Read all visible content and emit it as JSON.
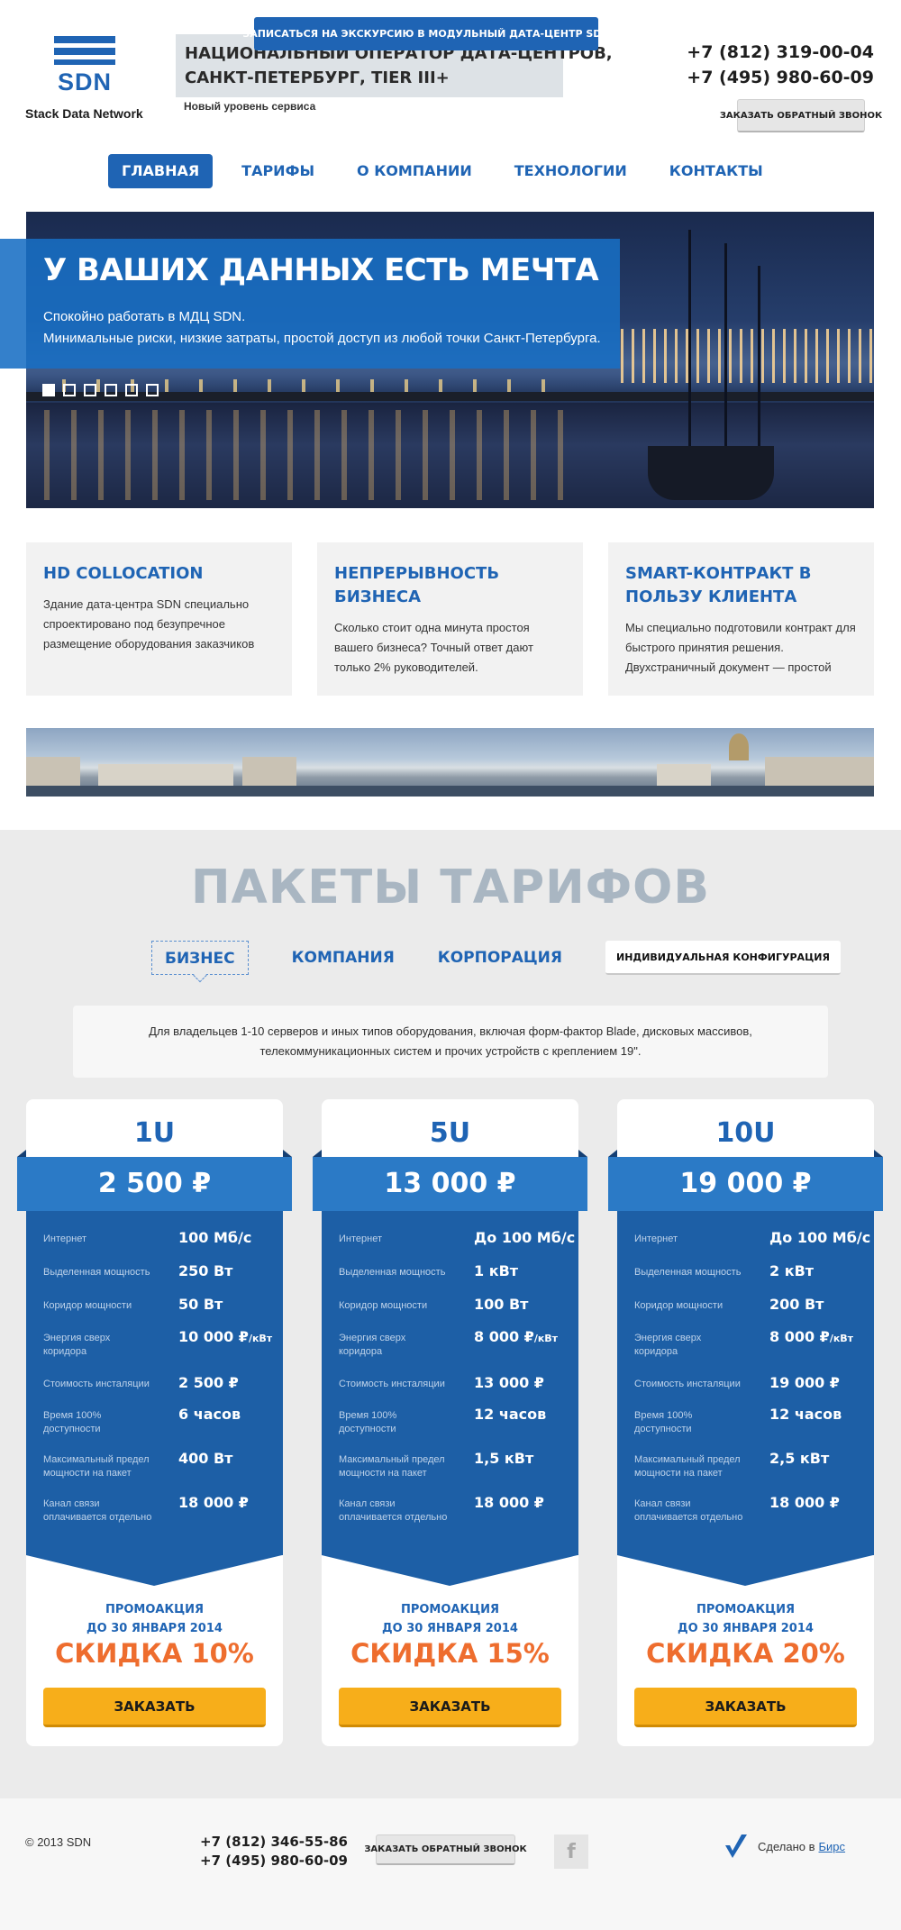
{
  "logo": {
    "text": "SDN",
    "subtitle": "Stack Data Network"
  },
  "header": {
    "headline_line1": "НАЦИОНАЛЬНЫЙ ОПЕРАТОР ДАТА-ЦЕНТРОВ,",
    "headline_line2": "САНКТ-ПЕТЕРБУРГ, TIER III+",
    "tagline": "Новый уровень сервиса",
    "phone1": "+7 (812) 319-00-04",
    "phone2": "+7 (495) 980-60-09",
    "callback_label": "ЗАКАЗАТЬ ОБРАТНЫЙ ЗВОНОК"
  },
  "nav": {
    "items": [
      "ГЛАВНАЯ",
      "ТАРИФЫ",
      "О КОМПАНИИ",
      "ТЕХНОЛОГИИ",
      "КОНТАКТЫ"
    ],
    "active": "ГЛАВНАЯ"
  },
  "hero": {
    "title": "У ВАШИХ ДАННЫХ ЕСТЬ МЕЧТА",
    "line1": "Спокойно работать в МДЦ SDN.",
    "line2": "Минимальные риски, низкие затраты, простой доступ из любой точки Санкт-Петербурга.",
    "slides_count": 6,
    "active_slide": 1
  },
  "features": [
    {
      "title": "HD COLLOCATION",
      "text": "Здание дата-центра SDN специально спроектировано под безупречное размещение оборудования заказчиков"
    },
    {
      "title": "НЕПРЕРЫВНОСТЬ БИЗНЕСА",
      "text": "Сколько стоит одна минута простоя вашего бизнеса? Точный ответ дают только 2% руководителей."
    },
    {
      "title": "SMART-КОНТРАКТ В ПОЛЬЗУ КЛИЕНТА",
      "text": "Мы специально подготовили контракт для быстрого принятия решения. Двухстраничный документ — простой"
    }
  ],
  "banner": {
    "button_label": "ЗАПИСАТЬСЯ НА ЭКСКУРСИЮ В МОДУЛЬНЫЙ ДАТА-ЦЕНТР SDN"
  },
  "tariffs": {
    "title": "ПАКЕТЫ ТАРИФОВ",
    "tabs": [
      "БИЗНЕС",
      "КОМПАНИЯ",
      "КОРПОРАЦИЯ",
      "ИНДИВИДУАЛЬНАЯ КОНФИГУРАЦИЯ"
    ],
    "active_tab": "БИЗНЕС",
    "description": "Для владельцев 1-10 серверов и иных типов оборудования, включая форм-фактор Blade, дисковых массивов, телекоммуникационных систем и прочих устройств с креплением 19\".",
    "spec_labels": [
      "Интернет",
      "Выделенная мощность",
      "Коридор мощности",
      "Энергия сверх коридора",
      "Стоимость инсталяции",
      "Время 100% доступности",
      "Максимальный предел мощности на пакет",
      "Канал связи оплачивается отдельно"
    ],
    "plans": [
      {
        "units": "1U",
        "price": "2 500 ₽",
        "specs": [
          "100 Мб/с",
          "250 Вт",
          "50 Вт",
          "10 000 ₽",
          "2 500 ₽",
          "6 часов",
          "400 Вт",
          "18 000 ₽"
        ],
        "energy_unit": "/кВт",
        "promo_line1": "ПРОМОАКЦИЯ",
        "promo_line2": "ДО 30 ЯНВАРЯ 2014",
        "discount": "СКИДКА 10%",
        "order_label": "ЗАКАЗАТЬ"
      },
      {
        "units": "5U",
        "price": "13 000 ₽",
        "specs": [
          "До 100 Мб/с",
          "1 кВт",
          "100 Вт",
          "8 000 ₽",
          "13 000 ₽",
          "12 часов",
          "1,5 кВт",
          "18 000 ₽"
        ],
        "energy_unit": "/кВт",
        "promo_line1": "ПРОМОАКЦИЯ",
        "promo_line2": "ДО 30 ЯНВАРЯ 2014",
        "discount": "СКИДКА 15%",
        "order_label": "ЗАКАЗАТЬ"
      },
      {
        "units": "10U",
        "price": "19 000 ₽",
        "specs": [
          "До 100 Мб/с",
          "2 кВт",
          "200 Вт",
          "8 000 ₽",
          "19 000 ₽",
          "12 часов",
          "2,5 кВт",
          "18 000 ₽"
        ],
        "energy_unit": "/кВт",
        "promo_line1": "ПРОМОАКЦИЯ",
        "promo_line2": "ДО 30 ЯНВАРЯ 2014",
        "discount": "СКИДКА 20%",
        "order_label": "ЗАКАЗАТЬ"
      }
    ]
  },
  "footer": {
    "copyright": "© 2013 SDN",
    "phone1": "+7 (812) 346-55-86",
    "phone2": "+7 (495) 980-60-09",
    "callback_label": "ЗАКАЗАТЬ ОБРАТНЫЙ ЗВОНОК",
    "facebook_icon": "f",
    "made_by_text": "Сделано в",
    "made_by_link": "Бирс"
  },
  "colors": {
    "brand_blue": "#1f64b4",
    "card_blue": "#1d5fa6",
    "ribbon_blue": "#2b7ac6",
    "orange": "#ee6d2e",
    "yellow": "#f7ae1a"
  }
}
